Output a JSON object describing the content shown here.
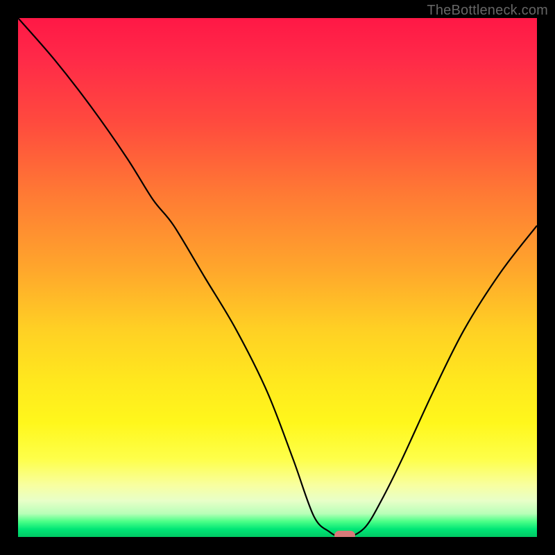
{
  "watermark": "TheBottleneck.com",
  "colors": {
    "page_bg": "#000000",
    "curve": "#000000",
    "marker": "#d87a7a",
    "watermark": "#666666"
  },
  "chart_data": {
    "type": "line",
    "title": "",
    "xlabel": "",
    "ylabel": "",
    "xlim": [
      0,
      100
    ],
    "ylim": [
      0,
      100
    ],
    "series": [
      {
        "name": "bottleneck-curve",
        "x": [
          0,
          7,
          14,
          21,
          26,
          30,
          36,
          42,
          48,
          53,
          57,
          60,
          62,
          64,
          67,
          70,
          74,
          80,
          86,
          93,
          100
        ],
        "values": [
          100,
          92,
          83,
          73,
          65,
          60,
          50,
          40,
          28,
          15,
          4,
          1,
          0,
          0,
          2,
          7,
          15,
          28,
          40,
          51,
          60
        ]
      }
    ],
    "marker": {
      "x": 63,
      "y": 0
    },
    "annotations": [],
    "grid": false,
    "legend": false
  }
}
